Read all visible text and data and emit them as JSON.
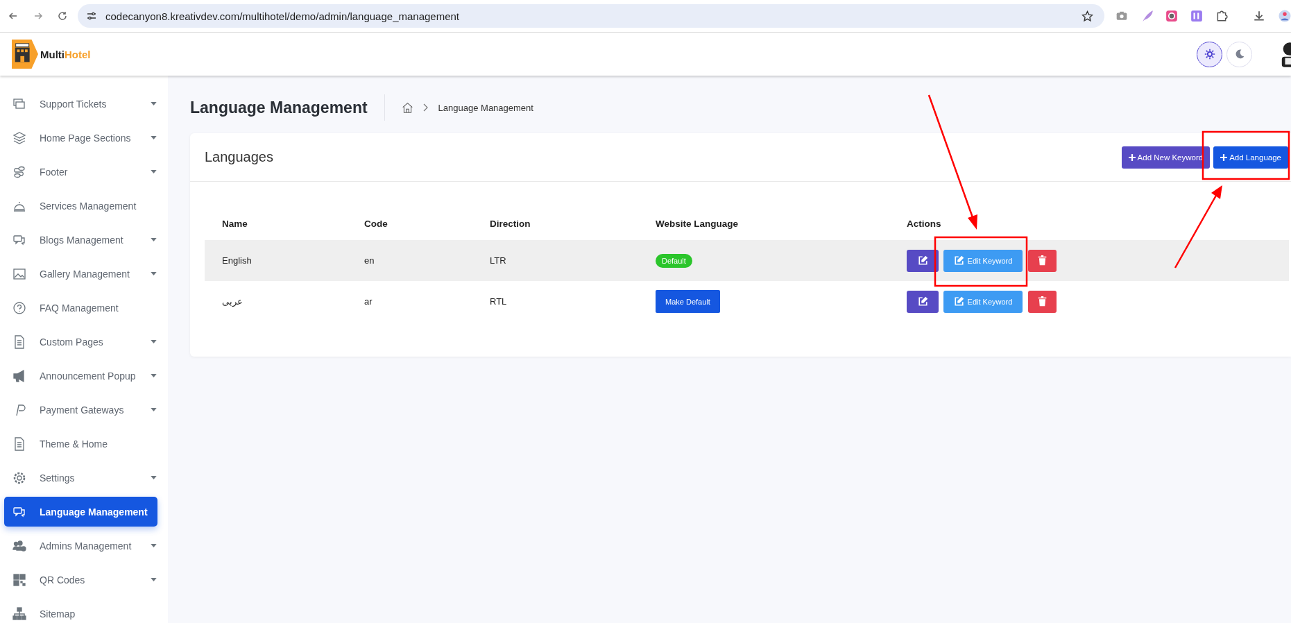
{
  "browser": {
    "url": "codecanyon8.kreativdev.com/multihotel/demo/admin/language_management"
  },
  "brand": {
    "first": "Multi",
    "second": "Hotel"
  },
  "theme_buttons": [
    {
      "selected": true
    },
    {
      "selected": false
    }
  ],
  "sidebar": {
    "items": [
      {
        "label": "Support Tickets",
        "dropdown": true,
        "selected": false
      },
      {
        "label": "Home Page Sections",
        "dropdown": true,
        "selected": false
      },
      {
        "label": "Footer",
        "dropdown": true,
        "selected": false
      },
      {
        "label": "Services Management",
        "dropdown": false,
        "selected": false
      },
      {
        "label": "Blogs Management",
        "dropdown": true,
        "selected": false
      },
      {
        "label": "Gallery Management",
        "dropdown": true,
        "selected": false
      },
      {
        "label": "FAQ Management",
        "dropdown": false,
        "selected": false
      },
      {
        "label": "Custom Pages",
        "dropdown": true,
        "selected": false
      },
      {
        "label": "Announcement Popup",
        "dropdown": true,
        "selected": false
      },
      {
        "label": "Payment Gateways",
        "dropdown": true,
        "selected": false
      },
      {
        "label": "Theme & Home",
        "dropdown": false,
        "selected": false
      },
      {
        "label": "Settings",
        "dropdown": true,
        "selected": false
      },
      {
        "label": "Language Management",
        "dropdown": false,
        "selected": true
      },
      {
        "label": "Admins Management",
        "dropdown": true,
        "selected": false
      },
      {
        "label": "QR Codes",
        "dropdown": true,
        "selected": false
      },
      {
        "label": "Sitemap",
        "dropdown": false,
        "selected": false
      }
    ]
  },
  "page_title": "Language Management",
  "breadcrumb": [
    "Language Management"
  ],
  "card": {
    "title": "Languages",
    "buttons": [
      {
        "label": "Add New Keyword",
        "kind": "secondary"
      },
      {
        "label": "Add Language",
        "kind": "primary"
      }
    ],
    "table": {
      "columns": [
        "Name",
        "Code",
        "Direction",
        "Website Language",
        "Actions"
      ],
      "rows": [
        {
          "name": "English",
          "code": "en",
          "direction": "LTR",
          "website_language": "Default",
          "is_default": true,
          "highlighted": true,
          "edit_keyword": "Edit Keyword"
        },
        {
          "name": "عربى",
          "code": "ar",
          "direction": "RTL",
          "website_language": "Make Default",
          "is_default": false,
          "highlighted": false,
          "edit_keyword": "Edit Keyword"
        }
      ]
    }
  }
}
